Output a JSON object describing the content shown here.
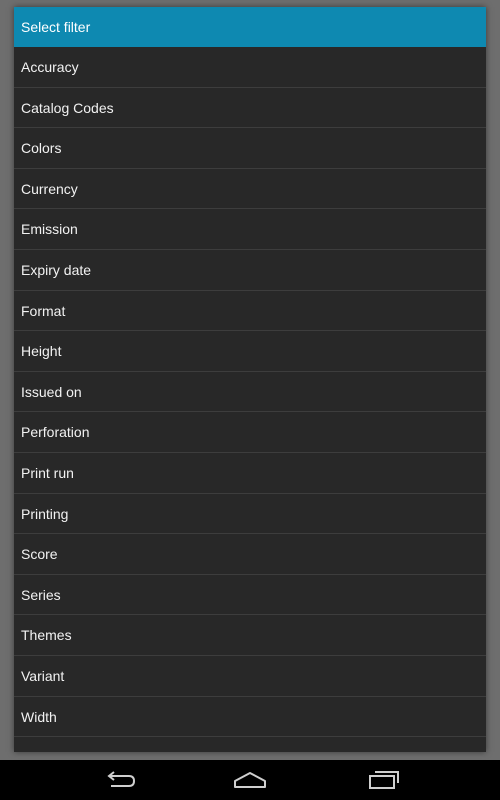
{
  "dialog": {
    "title": "Select filter",
    "items": [
      {
        "label": "Accuracy"
      },
      {
        "label": "Catalog Codes"
      },
      {
        "label": "Colors"
      },
      {
        "label": "Currency"
      },
      {
        "label": "Emission"
      },
      {
        "label": "Expiry date"
      },
      {
        "label": "Format"
      },
      {
        "label": "Height"
      },
      {
        "label": "Issued on"
      },
      {
        "label": "Perforation"
      },
      {
        "label": "Print run"
      },
      {
        "label": "Printing"
      },
      {
        "label": "Score"
      },
      {
        "label": "Series"
      },
      {
        "label": "Themes"
      },
      {
        "label": "Variant"
      },
      {
        "label": "Width"
      }
    ]
  },
  "colors": {
    "title_bar": "#0e89b1",
    "list_background": "#282828",
    "divider": "#3d3d3d",
    "backdrop": "#6e6e6e",
    "nav_bar": "#000000"
  },
  "nav_bar": {
    "buttons": [
      {
        "icon": "back-icon"
      },
      {
        "icon": "home-icon"
      },
      {
        "icon": "recent-apps-icon"
      }
    ]
  }
}
